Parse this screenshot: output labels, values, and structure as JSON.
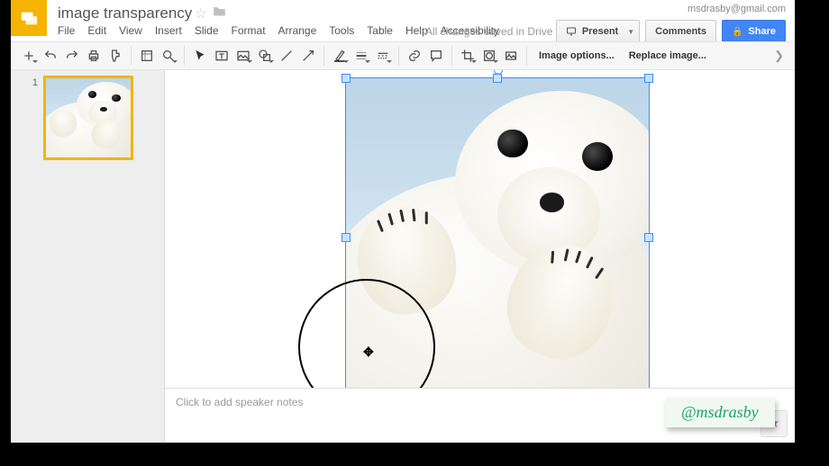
{
  "header": {
    "title": "image transparency",
    "user_email": "msdrasby@gmail.com"
  },
  "menu": {
    "file": "File",
    "edit": "Edit",
    "view": "View",
    "insert": "Insert",
    "slide": "Slide",
    "format": "Format",
    "arrange": "Arrange",
    "tools": "Tools",
    "table": "Table",
    "help": "Help",
    "accessibility": "Accessibility",
    "saved": "All changes saved in Drive"
  },
  "buttons": {
    "present": "Present",
    "comments": "Comments",
    "share": "Share"
  },
  "toolbar": {
    "image_options": "Image options...",
    "replace_image": "Replace image..."
  },
  "sidebar": {
    "slides": [
      {
        "number": "1"
      }
    ]
  },
  "notes": {
    "placeholder": "Click to add speaker notes"
  },
  "badge": {
    "text": "@msdrasby"
  }
}
